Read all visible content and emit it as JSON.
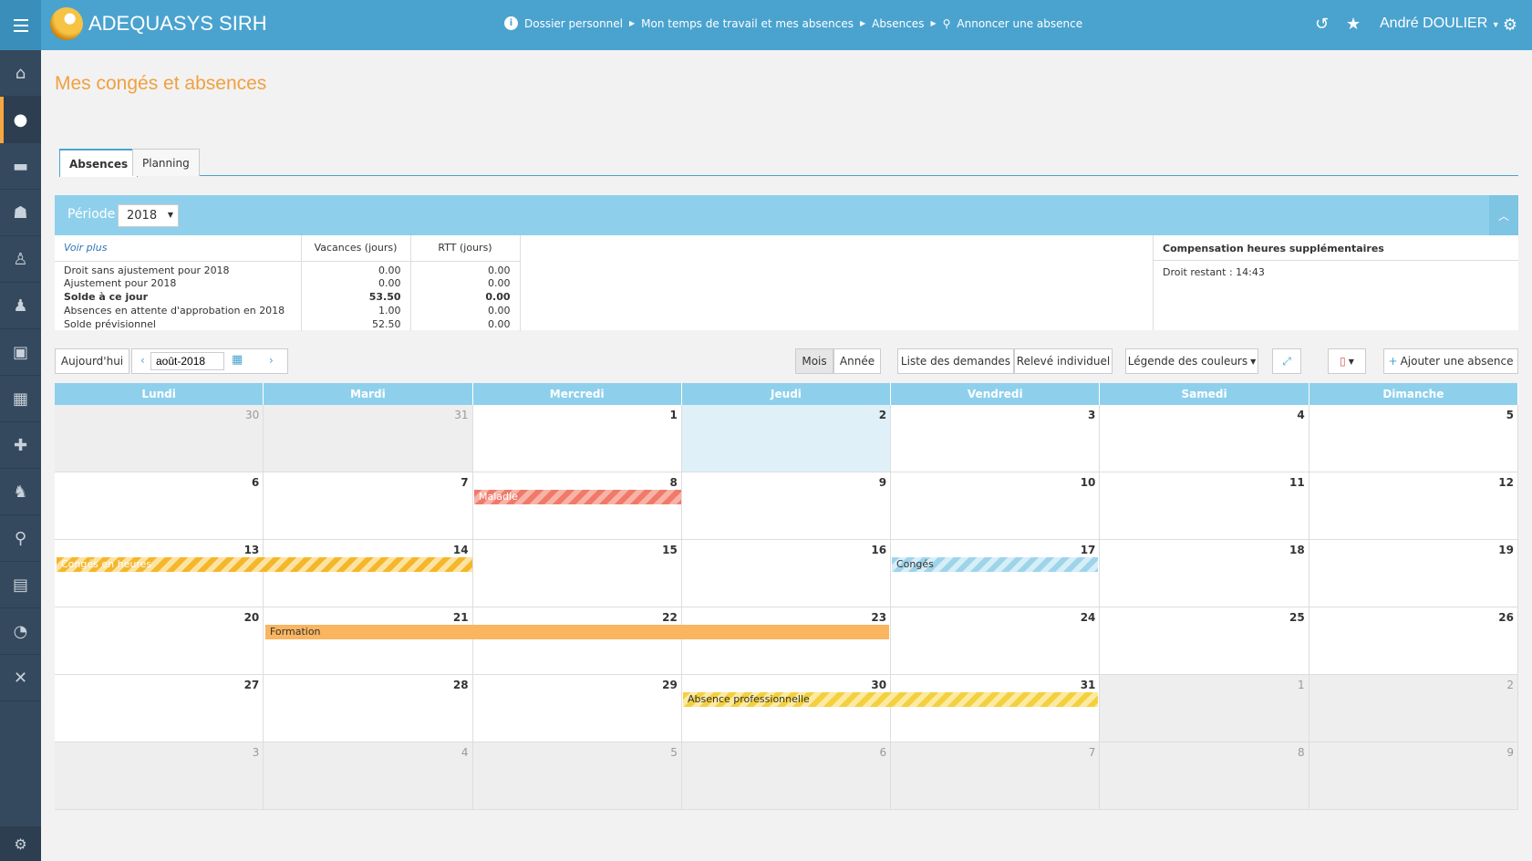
{
  "app": {
    "title": "ADEQUASYS SIRH"
  },
  "breadcrumb": [
    "Dossier personnel",
    "Mon temps de travail et mes absences",
    "Absences",
    "Annoncer une absence"
  ],
  "user": {
    "name": "André DOULIER"
  },
  "page": {
    "title": "Mes congés et absences"
  },
  "tabs": [
    {
      "label": "Absences",
      "active": true
    },
    {
      "label": "Planning",
      "active": false
    }
  ],
  "periode": {
    "label": "Période",
    "value": "2018"
  },
  "summary": {
    "voir_plus": "Voir plus",
    "col_vacances": "Vacances (jours)",
    "col_rtt": "RTT (jours)",
    "rows": [
      {
        "label": "Droit sans ajustement pour 2018",
        "vacances": "0.00",
        "rtt": "0.00",
        "bold": false
      },
      {
        "label": "Ajustement pour 2018",
        "vacances": "0.00",
        "rtt": "0.00",
        "bold": false
      },
      {
        "label": "Solde à ce jour",
        "vacances": "53.50",
        "rtt": "0.00",
        "bold": true
      },
      {
        "label": "Absences en attente d'approbation en 2018",
        "vacances": "1.00",
        "rtt": "0.00",
        "bold": false
      },
      {
        "label": "Solde prévisionnel",
        "vacances": "52.50",
        "rtt": "0.00",
        "bold": false
      }
    ],
    "compensation_title": "Compensation heures supplémentaires",
    "compensation_value": "Droit restant : 14:43"
  },
  "toolbar": {
    "today": "Aujourd'hui",
    "date": "août-2018",
    "mois": "Mois",
    "annee": "Année",
    "liste": "Liste des demandes",
    "releve": "Relevé individuel",
    "legende": "Légende des couleurs",
    "ajouter": "Ajouter une absence"
  },
  "calendar": {
    "days": [
      "Lundi",
      "Mardi",
      "Mercredi",
      "Jeudi",
      "Vendredi",
      "Samedi",
      "Dimanche"
    ],
    "weeks": [
      [
        "30",
        "31",
        "1",
        "2",
        "3",
        "4",
        "5"
      ],
      [
        "6",
        "7",
        "8",
        "9",
        "10",
        "11",
        "12"
      ],
      [
        "13",
        "14",
        "15",
        "16",
        "17",
        "18",
        "19"
      ],
      [
        "20",
        "21",
        "22",
        "23",
        "24",
        "25",
        "26"
      ],
      [
        "27",
        "28",
        "29",
        "30",
        "31",
        "1",
        "2"
      ],
      [
        "3",
        "4",
        "5",
        "6",
        "7",
        "8",
        "9"
      ]
    ],
    "events": {
      "maladie": "Maladie",
      "conges_heures": "Congés en heures",
      "conges": "Congés",
      "formation": "Formation",
      "absence_pro": "Absence professionnelle"
    }
  },
  "colors": {
    "header": "#4aa3cf",
    "sidebar": "#34495e",
    "accent": "#f5a742"
  }
}
